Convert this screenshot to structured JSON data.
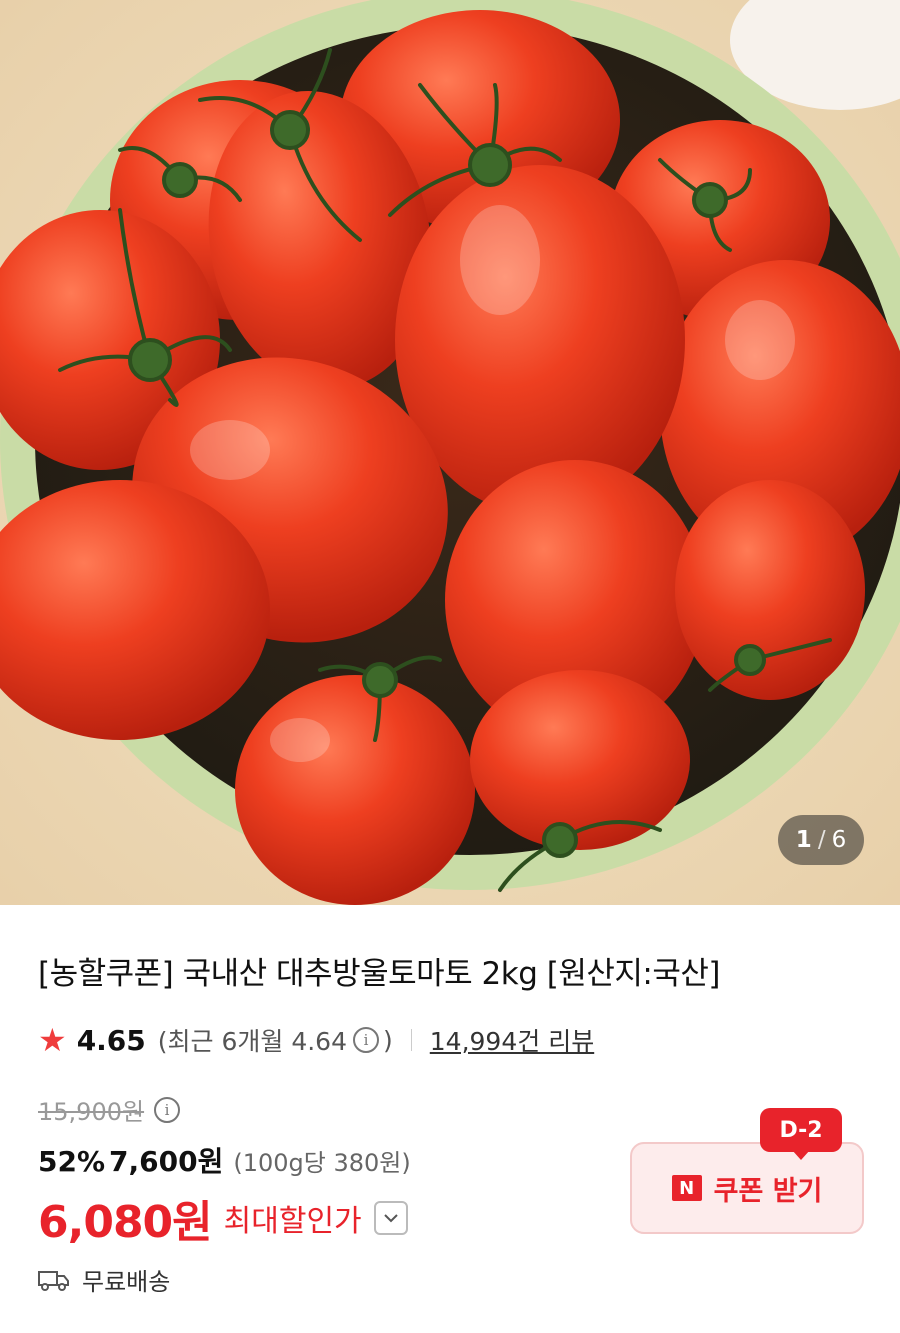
{
  "image": {
    "alt_icon": "cherry-tomatoes-photo",
    "counter_current": "1",
    "counter_separator": "/",
    "counter_total": "6"
  },
  "product": {
    "title": "[농할쿠폰] 국내산 대추방울토마토 2kg [원산지:국산]"
  },
  "rating": {
    "score": "4.65",
    "recent_text": "(최근 6개월 4.64",
    "recent_close": ")",
    "info_glyph": "i",
    "reviews": "14,994건 리뷰"
  },
  "price": {
    "original": "15,900원",
    "discount_pct": "52%",
    "discount_price": "7,600원",
    "unit_price": "(100g당 380원)",
    "final_price": "6,080원",
    "final_label": "최대할인가"
  },
  "coupon": {
    "badge": "D-2",
    "n_logo": "N",
    "label": "쿠폰 받기"
  },
  "shipping": {
    "label": "무료배송"
  },
  "colors": {
    "accent": "#e8232b",
    "star": "#ef3c3c",
    "coupon_bg": "#fdecec"
  }
}
